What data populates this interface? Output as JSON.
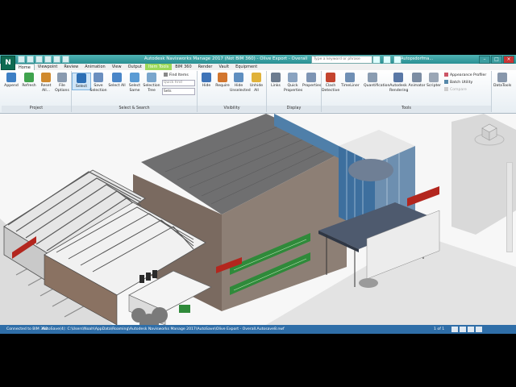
{
  "window": {
    "title": "Autodesk Navisworks Manage 2017 (Not BIM 360) - Olive Export - Overall",
    "app_letter": "N",
    "search_placeholder": "Type a keyword or phrase",
    "user": "Autopsdorfma..."
  },
  "tabs": [
    "Home",
    "Viewpoint",
    "Review",
    "Animation",
    "View",
    "Output",
    "Item Tools",
    "BIM 360",
    "Render",
    "Vault",
    "Equipment"
  ],
  "ribbon": {
    "project": {
      "label": "Project",
      "buttons": [
        "Append",
        "Refresh",
        "Reset All...",
        "File Options"
      ]
    },
    "select_search": {
      "label": "Select & Search",
      "buttons": [
        "Select",
        "Save Selection",
        "Select All",
        "Select Same",
        "Selection Tree"
      ],
      "find_items": "Find Items",
      "quick_find": "Quick Find",
      "sets": "Sets"
    },
    "visibility": {
      "label": "Visibility",
      "buttons": [
        "Hide",
        "Require",
        "Hide Unselected",
        "Unhide All"
      ]
    },
    "display": {
      "label": "Display",
      "buttons": [
        "Links",
        "Quick Properties",
        "Properties"
      ]
    },
    "tools": {
      "label": "Tools",
      "buttons": [
        "Clash Detective",
        "TimeLiner",
        "Quantification",
        "Autodesk Rendering",
        "Animator",
        "Scripter"
      ],
      "small": [
        "Appearance Profiler",
        "Batch Utility",
        "Compare"
      ]
    },
    "datatools": "DataTools"
  },
  "status": {
    "connected": "Connected to BIM 360",
    "path": "AutoSave(4): C:\\Users\\Noah\\AppData\\Roaming\\Autodesk Navisworks Manage 2017\\AutoSave\\Olive Export - Overall.Autosave8.nwf",
    "page": "1 of 1"
  },
  "colors": {
    "titlebar": "#2a8f92",
    "status_bar": "#2f6ea8",
    "context_tab": "#9bd85a"
  }
}
